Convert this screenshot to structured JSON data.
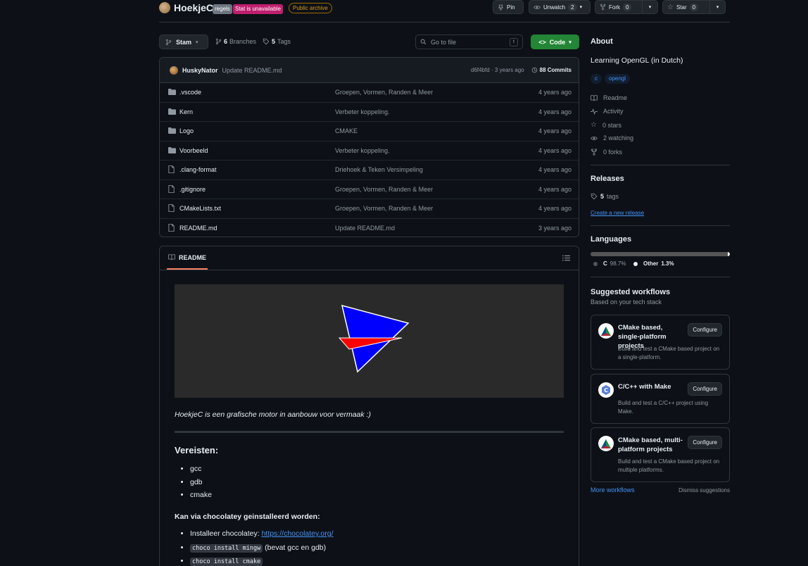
{
  "header": {
    "repo_name": "HoekjeC",
    "badge_regels": "regels",
    "badge_stat": "Stat is unavailable",
    "badge_archive": "Public archive",
    "pin": "Pin",
    "unwatch": "Unwatch",
    "watch_count": "2",
    "fork": "Fork",
    "fork_count": "0",
    "star": "Star",
    "star_count": "0"
  },
  "toolbar": {
    "branch": "Stam",
    "branches_count": "6",
    "branches_label": "Branches",
    "tags_count": "5",
    "tags_label": "Tags",
    "search_placeholder": "Go to file",
    "search_kbd": "t",
    "code": "Code"
  },
  "commit": {
    "author": "HuskyNator",
    "message": "Update README.md",
    "meta": "d6f4bfd · 3 years ago",
    "commits": "88 Commits"
  },
  "files": [
    {
      "type": "dir",
      "name": ".vscode",
      "message": "Groepen, Vormen, Randen & Meer",
      "time": "4 years ago"
    },
    {
      "type": "dir",
      "name": "Kern",
      "message": "Verbeter koppeling.",
      "time": "4 years ago"
    },
    {
      "type": "dir",
      "name": "Logo",
      "message": "CMAKE",
      "time": "4 years ago"
    },
    {
      "type": "dir",
      "name": "Voorbeeld",
      "message": "Verbeter koppeling.",
      "time": "4 years ago"
    },
    {
      "type": "file",
      "name": ".clang-format",
      "message": "Driehoek & Teken Versimpeling",
      "time": "4 years ago"
    },
    {
      "type": "file",
      "name": ".gitignore",
      "message": "Groepen, Vormen, Randen & Meer",
      "time": "4 years ago"
    },
    {
      "type": "file",
      "name": "CMakeLists.txt",
      "message": "Groepen, Vormen, Randen & Meer",
      "time": "4 years ago"
    },
    {
      "type": "file",
      "name": "README.md",
      "message": "Update README.md",
      "time": "3 years ago"
    }
  ],
  "readme": {
    "tab": "README",
    "tagline": "HoekjeC is een grafische motor in aanbouw voor vermaak :)",
    "req_heading": "Vereisten:",
    "requirements": [
      "gcc",
      "gdb",
      "cmake"
    ],
    "choco_heading": "Kan via chocolatey geinstalleerd worden:",
    "install_prefix": "Installeer chocolatey: ",
    "install_link": "https://chocolatey.org/",
    "cmd1": "choco install mingw",
    "cmd1_note": " (bevat gcc en gdb)",
    "cmd2": "choco install cmake"
  },
  "about": {
    "heading": "About",
    "description": "Learning OpenGL (in Dutch)",
    "topics": [
      "c",
      "opengl"
    ],
    "readme": "Readme",
    "activity": "Activity",
    "stars": "0 stars",
    "watching": "2 watching",
    "forks": "0 forks"
  },
  "releases": {
    "heading": "Releases",
    "tags_count": "5",
    "tags_label": "tags",
    "create": "Create a new release"
  },
  "languages": {
    "heading": "Languages",
    "items": [
      {
        "name": "C",
        "percent": "98.7%",
        "color": "#555555"
      },
      {
        "name": "Other",
        "percent": "1.3%",
        "color": "#ededed"
      }
    ]
  },
  "workflows": {
    "heading": "Suggested workflows",
    "subheading": "Based on your tech stack",
    "items": [
      {
        "title": "CMake based, single-platform projects",
        "desc": "Build and test a CMake based project on a single-platform.",
        "button": "Configure"
      },
      {
        "title": "C/C++ with Make",
        "desc": "Build and test a C/C++ project using Make.",
        "button": "Configure"
      },
      {
        "title": "CMake based, multi-platform projects",
        "desc": "Build and test a CMake based project on multiple platforms.",
        "button": "Configure"
      }
    ],
    "more": "More workflows",
    "dismiss": "Dismiss suggestions"
  },
  "colors": {
    "background": "#0d1117",
    "accent_link": "#4493f8",
    "code_button": "#238636",
    "tab_underline": "#f78166"
  }
}
